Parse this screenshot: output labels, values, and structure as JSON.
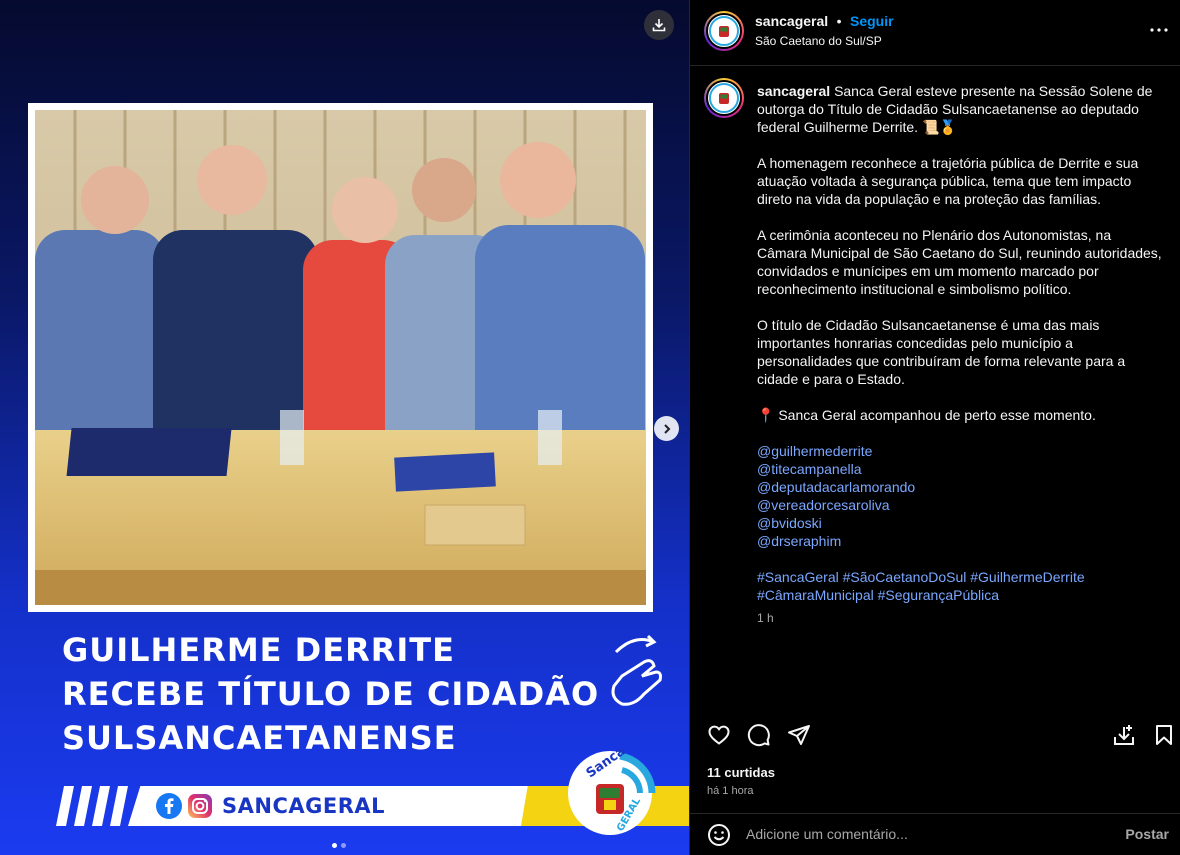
{
  "media": {
    "headline": [
      "GUILHERME DERRITE",
      "RECEBE TÍTULO DE CIDADÃO",
      "SULSANCAETANENSE"
    ],
    "brand_label": "SANCAGERAL",
    "logo_text_top": "Sanca",
    "logo_text_bottom": "GERAL",
    "slides_total": 2,
    "slide_active": 1
  },
  "header": {
    "username": "sancageral",
    "separator": "•",
    "follow_label": "Seguir",
    "location": "São Caetano do Sul/SP"
  },
  "caption": {
    "username": "sancageral",
    "first_line": "Sanca Geral esteve presente na Sessão Solene de outorga do Título de Cidadão Sulsancaetanense ao deputado federal Guilherme Derrite. 📜🏅",
    "paragraphs": [
      "A homenagem reconhece a trajetória pública de Derrite e sua atuação voltada à segurança pública, tema que tem impacto direto na vida da população e na proteção das famílias.",
      "A cerimônia aconteceu no Plenário dos Autonomistas, na Câmara Municipal de São Caetano do Sul, reunindo autoridades, convidados e munícipes em um momento marcado por reconhecimento institucional e simbolismo político.",
      "O título de Cidadão Sulsancaetanense é uma das mais importantes honrarias concedidas pelo município a personalidades que contribuíram de forma relevante para a cidade e para o Estado.",
      "📍 Sanca Geral acompanhou de perto esse momento."
    ],
    "mentions": [
      "@guilhermederrite",
      "@titecampanella",
      "@deputadacarlamorando",
      "@vereadorcesaroliva",
      "@bvidoski",
      "@drseraphim"
    ],
    "hashtags": "#SancaGeral #SãoCaetanoDoSul #GuilhermeDerrite #CâmaraMunicipal #SegurançaPública",
    "time": "1 h"
  },
  "footer": {
    "likes": "11 curtidas",
    "posted_ago": "há 1 hora",
    "comment_placeholder": "Adicione um comentário...",
    "post_label": "Postar"
  },
  "colors": {
    "accent": "#0095f6",
    "link": "#7aa7ff",
    "brand_blue": "#1935c4",
    "brand_yellow": "#f4d312"
  }
}
